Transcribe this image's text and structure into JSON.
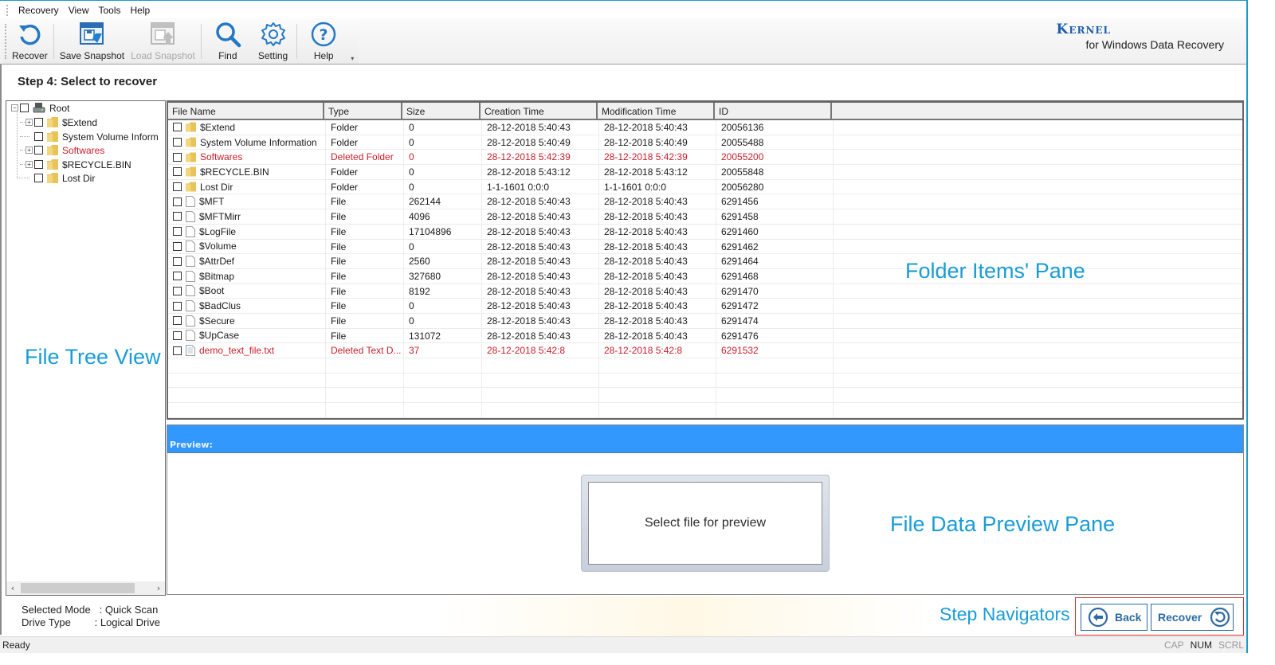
{
  "menu": [
    "Recovery",
    "View",
    "Tools",
    "Help"
  ],
  "toolbar": {
    "buttons": [
      {
        "label": "Recover",
        "icon": "recover-icon",
        "enabled": true
      },
      {
        "label": "Save Snapshot",
        "icon": "save-snapshot-icon",
        "enabled": true
      },
      {
        "label": "Load Snapshot",
        "icon": "load-snapshot-icon",
        "enabled": false
      },
      {
        "label": "Find",
        "icon": "search-icon",
        "enabled": true
      },
      {
        "label": "Setting",
        "icon": "gear-icon",
        "enabled": true
      },
      {
        "label": "Help",
        "icon": "help-icon",
        "enabled": true
      }
    ]
  },
  "brand": {
    "name": "Kernel",
    "subtitle": "for Windows Data Recovery"
  },
  "step_title": "Step 4: Select to recover",
  "tree": {
    "root": "Root",
    "children": [
      {
        "label": "$Extend",
        "expandable": true,
        "deleted": false
      },
      {
        "label": "System Volume Inform",
        "expandable": false,
        "deleted": false
      },
      {
        "label": "Softwares",
        "expandable": true,
        "deleted": true
      },
      {
        "label": "$RECYCLE.BIN",
        "expandable": true,
        "deleted": false
      },
      {
        "label": "Lost Dir",
        "expandable": false,
        "deleted": false
      }
    ]
  },
  "grid": {
    "columns": [
      "File Name",
      "Type",
      "Size",
      "Creation Time",
      "Modification Time",
      "ID"
    ],
    "rows": [
      {
        "name": "$Extend",
        "type": "Folder",
        "size": "0",
        "created": "28-12-2018 5:40:43",
        "modified": "28-12-2018 5:40:43",
        "id": "20056136",
        "kind": "folder",
        "deleted": false
      },
      {
        "name": "System Volume Information",
        "type": "Folder",
        "size": "0",
        "created": "28-12-2018 5:40:49",
        "modified": "28-12-2018 5:40:49",
        "id": "20055488",
        "kind": "folder",
        "deleted": false
      },
      {
        "name": "Softwares",
        "type": "Deleted Folder",
        "size": "0",
        "created": "28-12-2018 5:42:39",
        "modified": "28-12-2018 5:42:39",
        "id": "20055200",
        "kind": "folder",
        "deleted": true
      },
      {
        "name": "$RECYCLE.BIN",
        "type": "Folder",
        "size": "0",
        "created": "28-12-2018 5:43:12",
        "modified": "28-12-2018 5:43:12",
        "id": "20055848",
        "kind": "folder",
        "deleted": false
      },
      {
        "name": "Lost Dir",
        "type": "Folder",
        "size": "0",
        "created": "1-1-1601 0:0:0",
        "modified": "1-1-1601 0:0:0",
        "id": "20056280",
        "kind": "folder",
        "deleted": false
      },
      {
        "name": "$MFT",
        "type": "File",
        "size": "262144",
        "created": "28-12-2018 5:40:43",
        "modified": "28-12-2018 5:40:43",
        "id": "6291456",
        "kind": "file",
        "deleted": false
      },
      {
        "name": "$MFTMirr",
        "type": "File",
        "size": "4096",
        "created": "28-12-2018 5:40:43",
        "modified": "28-12-2018 5:40:43",
        "id": "6291458",
        "kind": "file",
        "deleted": false
      },
      {
        "name": "$LogFile",
        "type": "File",
        "size": "17104896",
        "created": "28-12-2018 5:40:43",
        "modified": "28-12-2018 5:40:43",
        "id": "6291460",
        "kind": "file",
        "deleted": false
      },
      {
        "name": "$Volume",
        "type": "File",
        "size": "0",
        "created": "28-12-2018 5:40:43",
        "modified": "28-12-2018 5:40:43",
        "id": "6291462",
        "kind": "file",
        "deleted": false
      },
      {
        "name": "$AttrDef",
        "type": "File",
        "size": "2560",
        "created": "28-12-2018 5:40:43",
        "modified": "28-12-2018 5:40:43",
        "id": "6291464",
        "kind": "file",
        "deleted": false
      },
      {
        "name": "$Bitmap",
        "type": "File",
        "size": "327680",
        "created": "28-12-2018 5:40:43",
        "modified": "28-12-2018 5:40:43",
        "id": "6291468",
        "kind": "file",
        "deleted": false
      },
      {
        "name": "$Boot",
        "type": "File",
        "size": "8192",
        "created": "28-12-2018 5:40:43",
        "modified": "28-12-2018 5:40:43",
        "id": "6291470",
        "kind": "file",
        "deleted": false
      },
      {
        "name": "$BadClus",
        "type": "File",
        "size": "0",
        "created": "28-12-2018 5:40:43",
        "modified": "28-12-2018 5:40:43",
        "id": "6291472",
        "kind": "file",
        "deleted": false
      },
      {
        "name": "$Secure",
        "type": "File",
        "size": "0",
        "created": "28-12-2018 5:40:43",
        "modified": "28-12-2018 5:40:43",
        "id": "6291474",
        "kind": "file",
        "deleted": false
      },
      {
        "name": "$UpCase",
        "type": "File",
        "size": "131072",
        "created": "28-12-2018 5:40:43",
        "modified": "28-12-2018 5:40:43",
        "id": "6291476",
        "kind": "file",
        "deleted": false
      },
      {
        "name": "demo_text_file.txt",
        "type": "Deleted Text D...",
        "size": "37",
        "created": "28-12-2018 5:42:8",
        "modified": "28-12-2018 5:42:8",
        "id": "6291532",
        "kind": "text",
        "deleted": true
      }
    ],
    "empty_rows": 4
  },
  "preview": {
    "header": "Preview:",
    "placeholder": "Select file for preview"
  },
  "annotations": {
    "tree": "File Tree View",
    "grid": "Folder Items' Pane",
    "preview": "File Data Preview Pane",
    "nav": "Step Navigators"
  },
  "info": {
    "mode_label": "Selected Mode",
    "mode_value": ": Quick Scan",
    "drive_label": "Drive Type",
    "drive_value": ": Logical Drive"
  },
  "nav": {
    "back": "Back",
    "recover": "Recover"
  },
  "status": {
    "text": "Ready",
    "indicators": [
      {
        "label": "CAP",
        "on": false
      },
      {
        "label": "NUM",
        "on": true
      },
      {
        "label": "SCRL",
        "on": false
      }
    ]
  },
  "colors": {
    "accent": "#1a9cd6",
    "deleted": "#c8202a",
    "preview_bar": "#3398fd",
    "nav_border": "#d42a2a",
    "nav_button": "#2d6aa0"
  }
}
